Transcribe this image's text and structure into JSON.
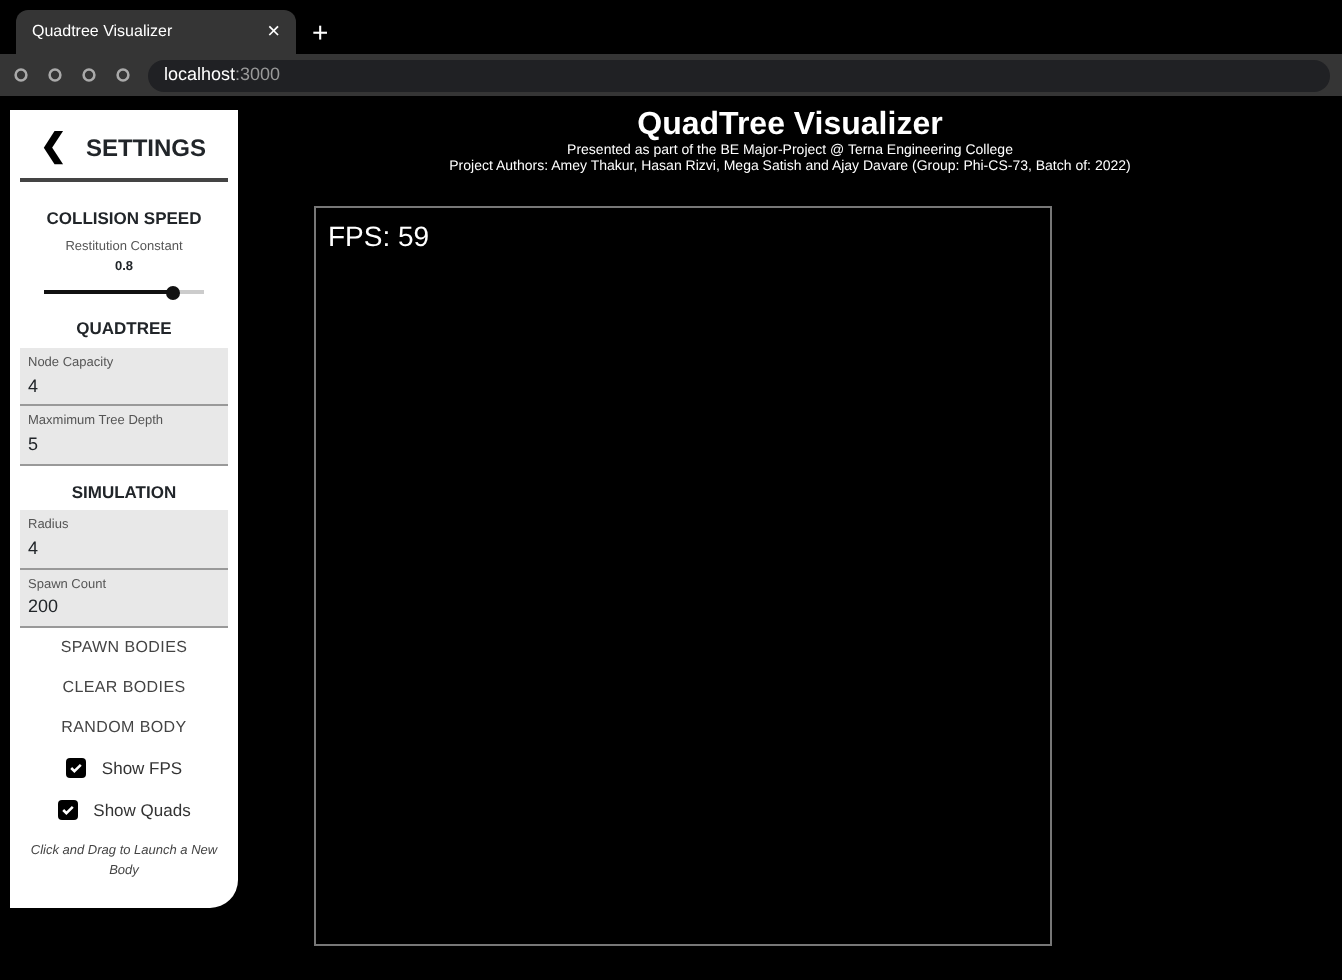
{
  "browser": {
    "tab_title": "Quadtree Visualizer",
    "tab_close": "×",
    "new_tab": "+",
    "address_host": "localhost",
    "address_port": ":3000"
  },
  "sidebar": {
    "back": "❮",
    "title": "SETTINGS",
    "sections": [
      {
        "heading": "COLLISION SPEED",
        "items": [
          {
            "kind": "slider",
            "label": "Restitution Constant",
            "reading": "0.8",
            "level": 0.8
          }
        ]
      },
      {
        "heading": "QUADTREE",
        "items": [
          {
            "kind": "field",
            "label": "Node Capacity",
            "value": "4"
          },
          {
            "kind": "field",
            "label": "Maxmimum Tree Depth",
            "value": "5"
          }
        ]
      },
      {
        "heading": "SIMULATION",
        "items": [
          {
            "kind": "field",
            "label": "Radius",
            "value": "4"
          },
          {
            "kind": "field",
            "label": "Spawn Count",
            "value": "200"
          },
          {
            "kind": "button",
            "label": "SPAWN BODIES"
          },
          {
            "kind": "button",
            "label": "CLEAR BODIES"
          },
          {
            "kind": "button",
            "label": "RANDOM BODY"
          },
          {
            "kind": "checkbox",
            "label": "Show FPS",
            "checked": true
          },
          {
            "kind": "checkbox",
            "label": "Show Quads",
            "checked": true
          }
        ]
      }
    ],
    "hint": "Click and Drag to Launch a New Body"
  },
  "header": {
    "title": "QuadTree Visualizer",
    "subtitle": "Presented as part of the BE Major-Project @ Terna Engineering College",
    "authors": "Project Authors: Amey Thakur, Hasan Rizvi, Mega Satish and Ajay Davare (Group: Phi-CS-73, Batch of: 2022)"
  },
  "canvas": {
    "fps": "FPS: 59"
  }
}
